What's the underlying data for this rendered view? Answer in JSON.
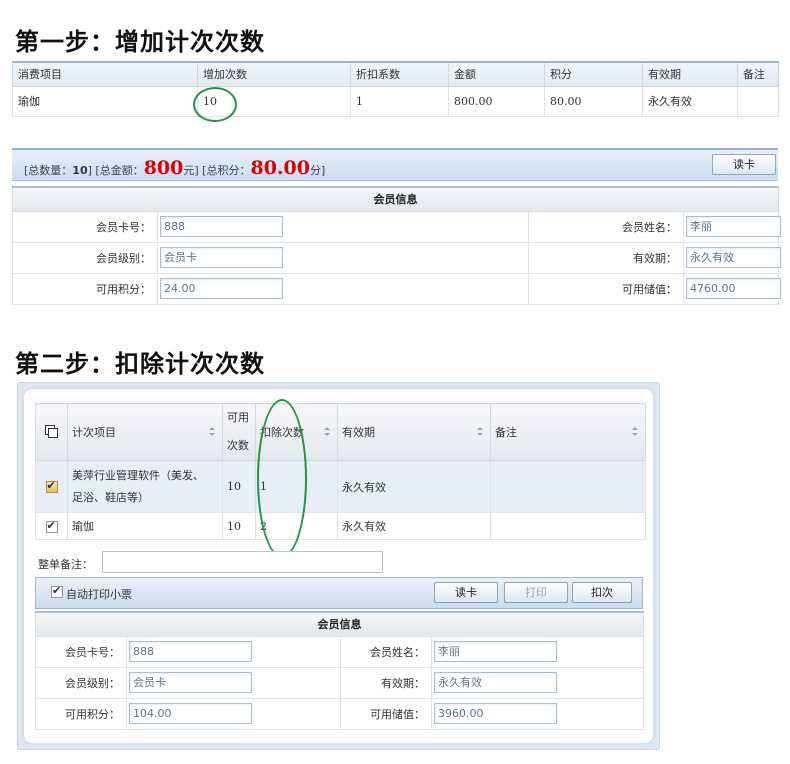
{
  "step1": {
    "title": "第一步：增加计次次数",
    "table": {
      "headers": [
        "消费项目",
        "增加次数",
        "折扣系数",
        "金额",
        "积分",
        "有效期",
        "备注"
      ],
      "row": [
        "瑜伽",
        "10",
        "1",
        "800.00",
        "80.00",
        "永久有效",
        ""
      ]
    },
    "summary": {
      "part1": "[总数量：",
      "qty": "10",
      "part2": "] [总金额：",
      "amount": "800",
      "part3": "元]  [总积分：",
      "points": "80.00",
      "part4": "分]"
    },
    "read_card_label": "读卡",
    "member": {
      "header": "会员信息",
      "rows": [
        {
          "l1": "会员卡号：",
          "v1": "888",
          "l2": "会员姓名：",
          "v2": "李丽"
        },
        {
          "l1": "会员级别：",
          "v1": "会员卡",
          "l2": "有效期：",
          "v2": "永久有效"
        },
        {
          "l1": "可用积分：",
          "v1": "24.00",
          "l2": "可用储值：",
          "v2": "4760.00"
        }
      ]
    }
  },
  "step2": {
    "title": "第二步：扣除计次次数",
    "table": {
      "headers": {
        "item": "计次项目",
        "avail_1": "可用",
        "avail_2": "次数",
        "deduct": "扣除次数",
        "validity": "有效期",
        "remark": "备注"
      },
      "rows": [
        {
          "item_1": "美萍行业管理软件（美发、",
          "item_2": "足浴、鞋店等）",
          "avail": "10",
          "deduct": "1",
          "validity": "永久有效",
          "remark": ""
        },
        {
          "item": "瑜伽",
          "avail": "10",
          "deduct": "2",
          "validity": "永久有效",
          "remark": ""
        }
      ]
    },
    "remark_label": "整单备注：",
    "auto_print_label": "自动打印小票",
    "buttons": {
      "read_card": "读卡",
      "print": "打印",
      "deduct": "扣次"
    },
    "member": {
      "header": "会员信息",
      "rows": [
        {
          "l1": "会员卡号：",
          "v1": "888",
          "l2": "会员姓名：",
          "v2": "李丽"
        },
        {
          "l1": "会员级别：",
          "v1": "会员卡",
          "l2": "有效期：",
          "v2": "永久有效"
        },
        {
          "l1": "可用积分：",
          "v1": "104.00",
          "l2": "可用储值：",
          "v2": "3960.00"
        }
      ]
    }
  },
  "colors": {
    "annotation_oval": "#1a9a42",
    "total_red": "#e00000",
    "header_blue": "#9ab5d2"
  }
}
